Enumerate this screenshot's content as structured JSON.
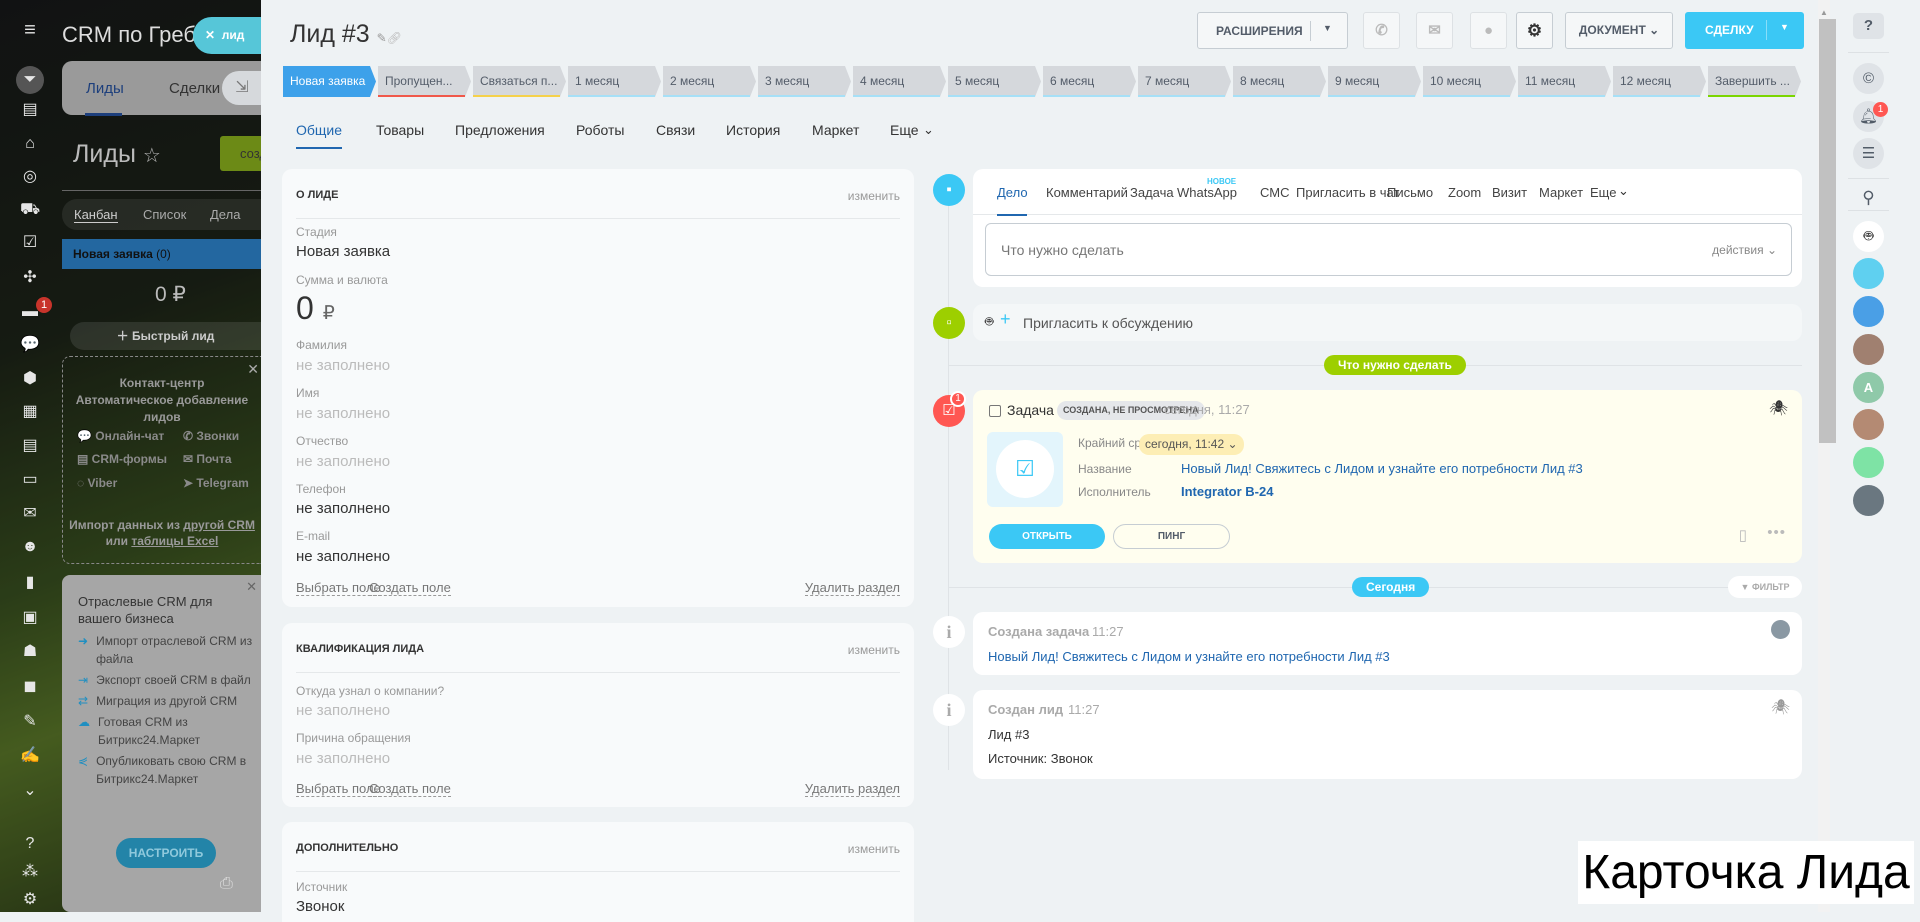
{
  "app": {
    "title": "CRM по Гребе",
    "close_pill": "лид",
    "tabs": [
      "Лиды",
      "Сделки"
    ],
    "page_title": "Лиды",
    "create_btn": "создать",
    "view_tabs": [
      "Канбан",
      "Список",
      "Дела"
    ],
    "column": {
      "name": "Новая заявка",
      "count": "(0)",
      "sum": "0 ₽",
      "quick": "Быстрый лид"
    },
    "contact_center": {
      "title": "Контакт-центр",
      "subtitle": "Автоматическое добавление лидов",
      "channels": [
        "Онлайн-чат",
        "Звонки",
        "CRM-формы",
        "Почта",
        "Viber",
        "Telegram"
      ],
      "import_prefix": "Импорт данных из",
      "import_link1": "другой CRM",
      "import_or": "или",
      "import_link2": "таблицы Excel"
    },
    "industry": {
      "title": "Отраслевые CRM для вашего бизнеса",
      "items": [
        "Импорт отраслевой CRM из файла",
        "Экспорт своей CRM в файл",
        "Миграция из другой CRM",
        "Готовая CRM из Битрикс24.Маркет",
        "Опубликовать свою CRM в Битрикс24.Маркет"
      ],
      "button": "НАСТРОИТЬ"
    },
    "badge_count": "1"
  },
  "header": {
    "title": "Лид #3",
    "extensions": "РАСШИРЕНИЯ",
    "document": "ДОКУМЕНТ",
    "deal": "СДЕЛКУ"
  },
  "stages": [
    {
      "label": "Новая заявка",
      "color": "#3da1ea"
    },
    {
      "label": "Пропущен...",
      "color": "#f0584a"
    },
    {
      "label": "Связаться п...",
      "color": "#f5d14a"
    },
    {
      "label": "1 месяц",
      "color": "#a6e0f7"
    },
    {
      "label": "2 месяц",
      "color": "#a6e0f7"
    },
    {
      "label": "3 месяц",
      "color": "#a6e0f7"
    },
    {
      "label": "4 месяц",
      "color": "#a6e0f7"
    },
    {
      "label": "5 месяц",
      "color": "#a6e0f7"
    },
    {
      "label": "6 месяц",
      "color": "#a6e0f7"
    },
    {
      "label": "7 месяц",
      "color": "#a6e0f7"
    },
    {
      "label": "8 месяц",
      "color": "#a6e0f7"
    },
    {
      "label": "9 месяц",
      "color": "#a6e0f7"
    },
    {
      "label": "10 месяц",
      "color": "#a6e0f7"
    },
    {
      "label": "11 месяц",
      "color": "#a6e0f7"
    },
    {
      "label": "12 месяц",
      "color": "#a6e0f7"
    },
    {
      "label": "Завершить ...",
      "color": "#7bd500"
    }
  ],
  "tabs": [
    "Общие",
    "Товары",
    "Предложения",
    "Роботы",
    "Связи",
    "История",
    "Маркет",
    "Еще"
  ],
  "about": {
    "title": "О лиде",
    "edit": "изменить",
    "fields": [
      {
        "label": "Стадия",
        "value": "Новая заявка"
      },
      {
        "label": "Сумма и валюта",
        "value": "0",
        "currency": "₽"
      },
      {
        "label": "Фамилия",
        "value": "не заполнено"
      },
      {
        "label": "Имя",
        "value": "не заполнено"
      },
      {
        "label": "Отчество",
        "value": "не заполнено"
      },
      {
        "label": "Телефон",
        "value": "не заполнено"
      },
      {
        "label": "E-mail",
        "value": "не заполнено"
      }
    ],
    "select_field": "Выбрать поле",
    "create_field": "Создать поле",
    "delete_section": "Удалить раздел"
  },
  "qual": {
    "title": "Квалификация лида",
    "edit": "изменить",
    "fields": [
      {
        "label": "Откуда узнал о компании?",
        "value": "не заполнено"
      },
      {
        "label": "Причина обращения",
        "value": "не заполнено"
      }
    ],
    "select_field": "Выбрать поле",
    "create_field": "Создать поле",
    "delete_section": "Удалить раздел"
  },
  "extra": {
    "title": "Дополнительно",
    "edit": "изменить",
    "fields": [
      {
        "label": "Источник",
        "value": "Звонок"
      }
    ]
  },
  "composer": {
    "tabs": [
      "Дело",
      "Комментарий",
      "Задача",
      "WhatsApp",
      "СМС",
      "Пригласить в чат",
      "Письмо",
      "Zoom",
      "Визит",
      "Маркет",
      "Еще"
    ],
    "new_badge": "НОВОЕ",
    "placeholder": "Что нужно сделать",
    "actions": "действия"
  },
  "invite": "Пригласить к обсуждению",
  "todo_pill": "Что нужно сделать",
  "task": {
    "type": "Задача",
    "status": "СОЗДАНА, НЕ ПРОСМОТРЕНА",
    "time": "сегодня, 11:27",
    "deadline_label": "Крайний срок",
    "deadline": "сегодня, 11:42",
    "name_label": "Название",
    "name": "Новый Лид! Свяжитесь с Лидом и узнайте его потребности Лид #3",
    "assignee_label": "Исполнитель",
    "assignee": "Integrator B-24",
    "open": "ОТКРЫТЬ",
    "ping": "ПИНГ",
    "badge": "1"
  },
  "today_pill": "Сегодня",
  "filter": "ФИЛЬТР",
  "events": [
    {
      "title": "Создана задача",
      "time": "11:27",
      "lines": [
        "Новый Лид! Свяжитесь с Лидом и узнайте его потребности Лид #3"
      ]
    },
    {
      "title": "Создан лид",
      "time": "11:27",
      "lines": [
        "Лид #3",
        "Источник: Звонок"
      ]
    }
  ],
  "rail": {
    "notif_count": "1",
    "avatar_letter": "A"
  },
  "caption": "Карточка Лида"
}
